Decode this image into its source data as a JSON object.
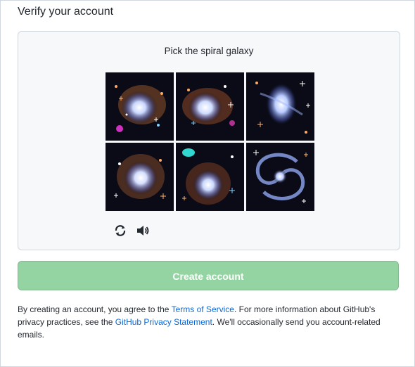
{
  "page": {
    "title": "Verify your account"
  },
  "captcha": {
    "prompt": "Pick the spiral galaxy",
    "tiles": [
      {
        "name": "galaxy-option-1",
        "kind": "irregular-galaxy"
      },
      {
        "name": "galaxy-option-2",
        "kind": "irregular-galaxy"
      },
      {
        "name": "galaxy-option-3",
        "kind": "irregular-galaxy"
      },
      {
        "name": "galaxy-option-4",
        "kind": "irregular-galaxy"
      },
      {
        "name": "galaxy-option-5",
        "kind": "irregular-galaxy"
      },
      {
        "name": "galaxy-option-6",
        "kind": "spiral-galaxy"
      }
    ],
    "controls": {
      "refresh_icon": "refresh-icon",
      "audio_icon": "speaker-icon"
    }
  },
  "create_button": {
    "label": "Create account",
    "state": "disabled"
  },
  "legal": {
    "part1": "By creating an account, you agree to the ",
    "terms_link": "Terms of Service",
    "part2": ". For more information about GitHub's privacy practices, see the ",
    "privacy_link": "GitHub Privacy Statement",
    "part3": ". We'll occasionally send you account-related emails."
  },
  "colors": {
    "button_disabled": "#94d3a2",
    "link": "#0969da",
    "tile_bg": "#0a0b16"
  }
}
